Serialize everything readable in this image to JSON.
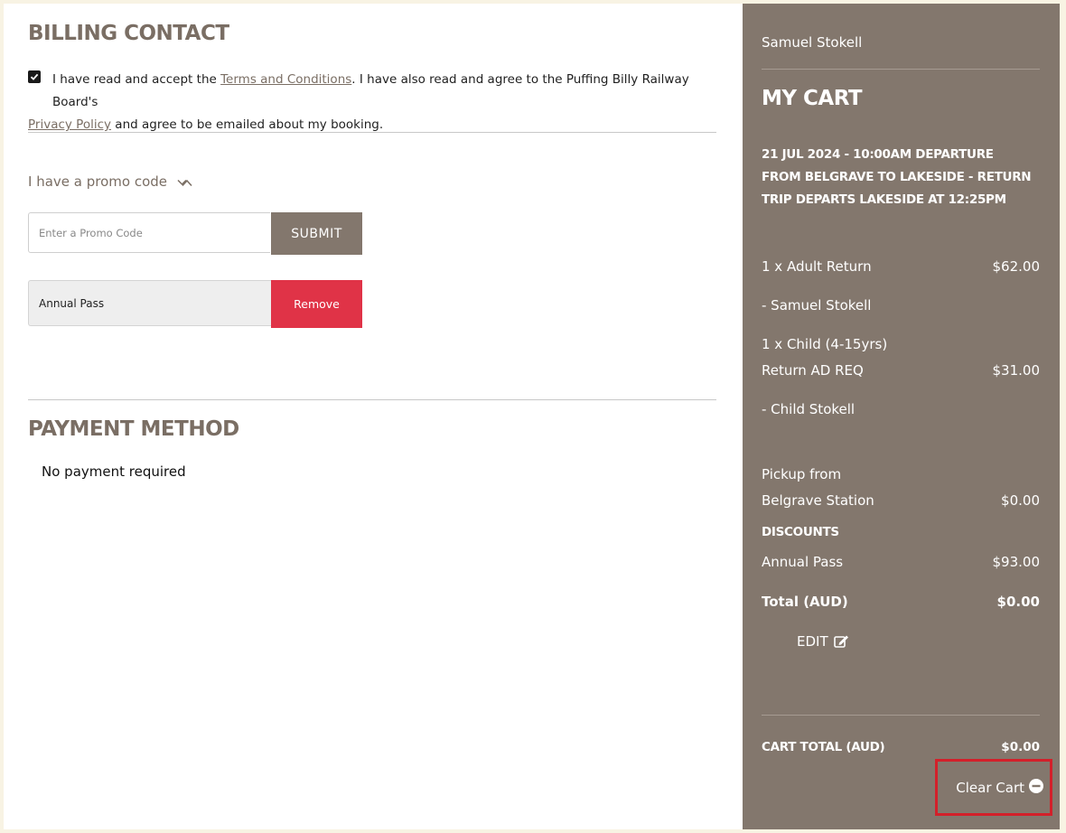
{
  "billing": {
    "heading": "BILLING CONTACT",
    "terms_before": "I have read and accept the ",
    "terms_link": "Terms and Conditions",
    "terms_middle": ". I have also read and agree to the Puffing Billy Railway Board's ",
    "privacy_link": "Privacy Policy",
    "terms_after": " and agree to be emailed about my booking."
  },
  "promo": {
    "toggle_label": "I have a promo code",
    "input_placeholder": "Enter a Promo Code",
    "submit_label": "SUBMIT",
    "applied_code": "Annual Pass",
    "remove_label": "Remove"
  },
  "payment": {
    "heading": "PAYMENT METHOD",
    "message": "No payment required"
  },
  "cart": {
    "user_name": "Samuel Stokell",
    "title": "MY CART",
    "trip": "21 JUL 2024 - 10:00AM DEPARTURE FROM BELGRAVE TO LAKESIDE - RETURN TRIP DEPARTS LAKESIDE AT 12:25PM",
    "items": [
      {
        "line1": "1 x Adult Return",
        "amount": "$62.00",
        "passenger": "- Samuel Stokell"
      },
      {
        "line1": "1 x Child (4-15yrs)",
        "line2": "Return AD REQ",
        "amount": "$31.00",
        "passenger": "- Child Stokell"
      }
    ],
    "pickup_line1": "Pickup from",
    "pickup_line2": "Belgrave Station",
    "pickup_amount": "$0.00",
    "discounts_label": "DISCOUNTS",
    "discount_name": "Annual Pass",
    "discount_amount": "$93.00",
    "total_label": "Total (AUD)",
    "total_amount": "$0.00",
    "edit_label": "EDIT",
    "cart_total_label": "CART TOTAL (AUD)",
    "cart_total_amount": "$0.00",
    "clear_label": "Clear Cart"
  },
  "colors": {
    "brand_taupe": "#83776d",
    "remove_red": "#e03347",
    "highlight_red": "#d3202a"
  }
}
